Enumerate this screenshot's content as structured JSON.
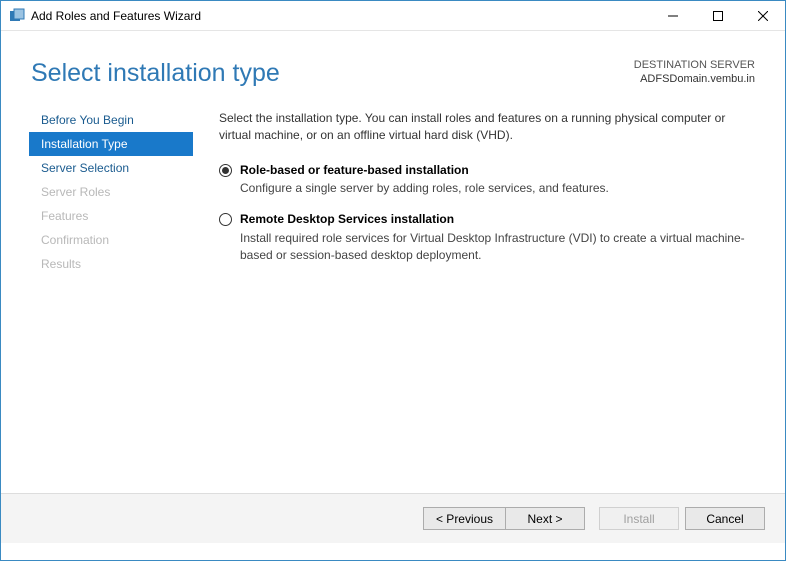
{
  "window": {
    "title": "Add Roles and Features Wizard"
  },
  "header": {
    "page_title": "Select installation type",
    "destination_label": "DESTINATION SERVER",
    "destination_server": "ADFSDomain.vembu.in"
  },
  "sidebar": {
    "items": [
      {
        "label": "Before You Begin",
        "state": "enabled"
      },
      {
        "label": "Installation Type",
        "state": "active"
      },
      {
        "label": "Server Selection",
        "state": "enabled"
      },
      {
        "label": "Server Roles",
        "state": "disabled"
      },
      {
        "label": "Features",
        "state": "disabled"
      },
      {
        "label": "Confirmation",
        "state": "disabled"
      },
      {
        "label": "Results",
        "state": "disabled"
      }
    ]
  },
  "content": {
    "intro": "Select the installation type. You can install roles and features on a running physical computer or virtual machine, or on an offline virtual hard disk (VHD).",
    "options": [
      {
        "selected": true,
        "title": "Role-based or feature-based installation",
        "desc": "Configure a single server by adding roles, role services, and features."
      },
      {
        "selected": false,
        "title": "Remote Desktop Services installation",
        "desc": "Install required role services for Virtual Desktop Infrastructure (VDI) to create a virtual machine-based or session-based desktop deployment."
      }
    ]
  },
  "footer": {
    "previous": "< Previous",
    "next": "Next >",
    "install": "Install",
    "cancel": "Cancel"
  }
}
